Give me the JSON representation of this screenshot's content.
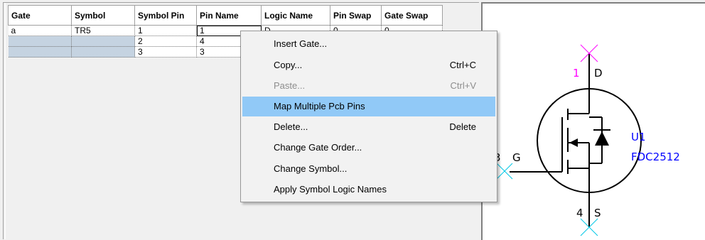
{
  "grid": {
    "columns": [
      "Gate",
      "Symbol",
      "Symbol Pin",
      "Pin Name",
      "Logic Name",
      "Pin Swap",
      "Gate Swap"
    ],
    "rows": [
      [
        "a",
        "TR5",
        "1",
        "1",
        "D",
        "0",
        "0"
      ],
      [
        "",
        "",
        "2",
        "4",
        "",
        "",
        ""
      ],
      [
        "",
        "",
        "3",
        "3",
        "",
        "",
        ""
      ]
    ]
  },
  "context_menu": {
    "items": [
      {
        "label": "Insert Gate...",
        "shortcut": "",
        "state": "normal"
      },
      {
        "label": "Copy...",
        "shortcut": "Ctrl+C",
        "state": "normal"
      },
      {
        "label": "Paste...",
        "shortcut": "Ctrl+V",
        "state": "disabled"
      },
      {
        "label": "Map Multiple Pcb Pins",
        "shortcut": "",
        "state": "highlighted"
      },
      {
        "label": "Delete...",
        "shortcut": "Delete",
        "state": "normal"
      },
      {
        "label": "Change Gate Order...",
        "shortcut": "",
        "state": "normal"
      },
      {
        "label": "Change Symbol...",
        "shortcut": "",
        "state": "normal"
      },
      {
        "label": "Apply Symbol Logic Names",
        "shortcut": "",
        "state": "normal"
      }
    ]
  },
  "schematic": {
    "ref_des": "U1",
    "part_name": "FDC2512",
    "pins": [
      {
        "number": "1",
        "name": "D"
      },
      {
        "number": "3",
        "name": "G"
      },
      {
        "number": "4",
        "name": "S"
      }
    ]
  },
  "colors": {
    "selection": "#c5d3e1",
    "menu_highlight": "#91c9f7",
    "pin_marker": "#ff00ff",
    "pin_marker_alt": "#00c8e6"
  }
}
